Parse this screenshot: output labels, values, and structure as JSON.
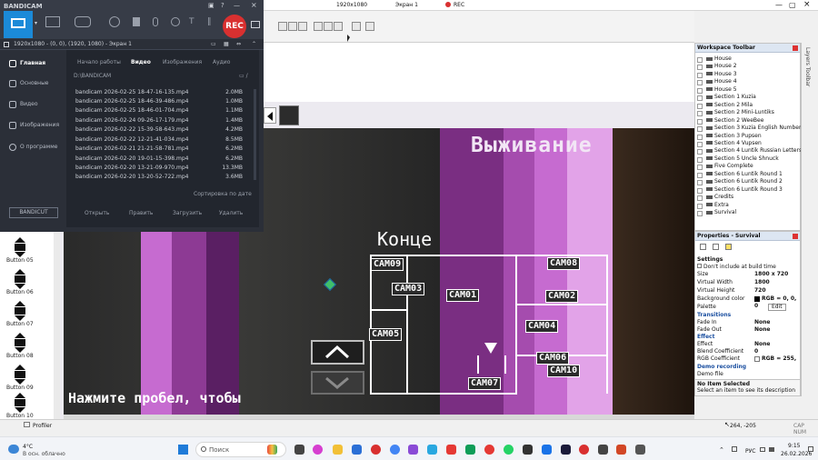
{
  "bandicam": {
    "logo": "BANDICAM",
    "rec_label": "REC",
    "status_left": "1920x1080 - (0, 0), (1920, 1080) - Экран 1",
    "nav": [
      "Главная",
      "Основные",
      "Видео",
      "Изображения",
      "О программе"
    ],
    "tabs": [
      "Начало работы",
      "Видео",
      "Изображения",
      "Аудио"
    ],
    "path": "D:\\BANDICAM",
    "files": [
      {
        "name": "bandicam 2026-02-25 18-47-16-135.mp4",
        "size": "2.0MB"
      },
      {
        "name": "bandicam 2026-02-25 18-46-39-486.mp4",
        "size": "1.0MB"
      },
      {
        "name": "bandicam 2026-02-25 18-46-01-704.mp4",
        "size": "1.1MB"
      },
      {
        "name": "bandicam 2026-02-24 09-26-17-179.mp4",
        "size": "1.4MB"
      },
      {
        "name": "bandicam 2026-02-22 15-39-58-643.mp4",
        "size": "4.2MB"
      },
      {
        "name": "bandicam 2026-02-22 12-21-41-034.mp4",
        "size": "8.5MB"
      },
      {
        "name": "bandicam 2026-02-21 21-21-58-781.mp4",
        "size": "6.2MB"
      },
      {
        "name": "bandicam 2026-02-20 19-01-15-398.mp4",
        "size": "6.2MB"
      },
      {
        "name": "bandicam 2026-02-20 13-21-09-970.mp4",
        "size": "13.3MB"
      },
      {
        "name": "bandicam 2026-02-20 13-20-52-722.mp4",
        "size": "3.6MB"
      }
    ],
    "sort": "Сортировка по дате",
    "actions": [
      "Открыть",
      "Править",
      "Загрузить",
      "Удалить"
    ],
    "bandicut": "BANDICUT"
  },
  "editor": {
    "topbar_title": "1920x1080",
    "topbar_screen": "Экран 1",
    "topbar_rec": "REC",
    "objects": [
      "Button 05",
      "Button 06",
      "Button 07",
      "Button 08",
      "Button 09",
      "Button 10"
    ],
    "scene": {
      "title": "Выживание",
      "concert": "Конце",
      "hint": "Нажмите пробел, чтобы",
      "cams": [
        "CAM09",
        "CAM08",
        "CAM03",
        "CAM01",
        "CAM02",
        "CAM05",
        "CAM04",
        "CAM06",
        "CAM10",
        "CAM07"
      ]
    }
  },
  "workspace": {
    "title": "Workspace Toolbar",
    "items": [
      "House",
      "House 2",
      "House 3",
      "House 4",
      "House 5",
      "Section 1 Kuzia",
      "Section 2 Mila",
      "Section 2 Mini-Luntiks",
      "Section 2 WeeBee",
      "Section 3 Kuzia English Number",
      "Section 3 Pupsen",
      "Section 4 Vupsen",
      "Section 4 Luntik Russian Letters",
      "Section 5 Uncle Shnuck",
      "Five Complete",
      "Section 6 Luntik Round 1",
      "Section 6 Luntik Round 2",
      "Section 6 Luntik Round 3",
      "Credits",
      "Extra",
      "Survival"
    ]
  },
  "properties": {
    "title": "Properties - Survival",
    "sec_settings": "Settings",
    "dont_include": "Don't include at build time",
    "rows": [
      {
        "label": "Size",
        "value": "1800 x 720"
      },
      {
        "label": "Virtual Width",
        "value": "1800"
      },
      {
        "label": "Virtual Height",
        "value": "720"
      },
      {
        "label": "Background color",
        "value": "RGB = 0, 0, 0"
      },
      {
        "label": "Palette",
        "value": "Edit"
      }
    ],
    "sec_transitions": "Transitions",
    "rows2": [
      {
        "label": "Fade In",
        "value": "None"
      },
      {
        "label": "Fade Out",
        "value": "None"
      }
    ],
    "sec_effect": "Effect",
    "rows3": [
      {
        "label": "Effect",
        "value": "None"
      },
      {
        "label": "Blend Coefficient",
        "value": "0"
      },
      {
        "label": "RGB Coefficient",
        "value": "RGB = 255,"
      }
    ],
    "sec_demo": "Demo recording",
    "demo_file": "Demo file",
    "info_title": "No Item Selected",
    "info_text": "Select an item to see its description"
  },
  "layers_label": "Layers Toolbar",
  "statusbar": {
    "profiler": "Profiler",
    "coords": "264, -205",
    "cap": "CAP NUM"
  },
  "taskbar": {
    "temp": "4°C",
    "weather": "В осн. облачно",
    "search": "Поиск",
    "lang": "РУС",
    "time": "9:15",
    "date": "26.02.2026"
  },
  "colors": {
    "rec_red": "#d93030",
    "bandicam_bg": "#2b2f38",
    "purple_dark": "#5a1f63",
    "purple_mid": "#8d3a94",
    "purple_light": "#c66bd0",
    "purple_pale": "#e2a3e8"
  }
}
